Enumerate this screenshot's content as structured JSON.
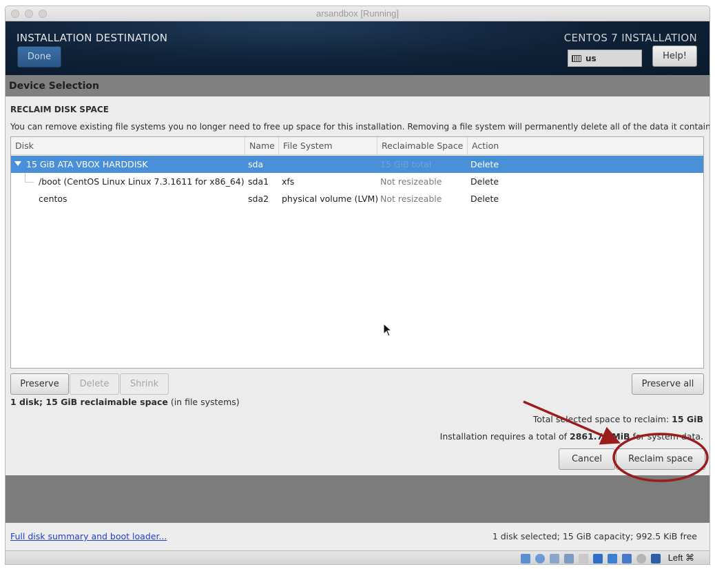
{
  "window": {
    "title": "arsandbox [Running]"
  },
  "header": {
    "title": "INSTALLATION DESTINATION",
    "done_label": "Done",
    "product": "CENTOS 7 INSTALLATION",
    "keyboard_layout": "us",
    "help_label": "Help!"
  },
  "dialog": {
    "section_header": "Device Selection",
    "title": "RECLAIM DISK SPACE",
    "description": "You can remove existing file systems you no longer need to free up space for this installation.  Removing a file system will permanently delete all of the data it contains.",
    "columns": [
      "Disk",
      "Name",
      "File System",
      "Reclaimable Space",
      "Action"
    ],
    "rows": [
      {
        "disk": "15 GiB ATA VBOX HARDDISK",
        "name": "sda",
        "fs": "",
        "reclaimable": "15 GiB total",
        "action": "Delete"
      },
      {
        "disk": "/boot (CentOS Linux Linux 7.3.1611 for x86_64)",
        "name": "sda1",
        "fs": "xfs",
        "reclaimable": "Not resizeable",
        "action": "Delete"
      },
      {
        "disk": "centos",
        "name": "sda2",
        "fs": "physical volume (LVM)",
        "reclaimable": "Not resizeable",
        "action": "Delete"
      }
    ],
    "buttons": {
      "preserve": "Preserve",
      "delete": "Delete",
      "shrink": "Shrink",
      "preserve_all": "Preserve all",
      "cancel": "Cancel",
      "reclaim": "Reclaim space"
    },
    "summary_bold": "1 disk; 15 GiB reclaimable space",
    "summary_rest": " (in file systems)",
    "total_label": "Total selected space to reclaim: ",
    "total_value": "15 GiB",
    "requires_pre": "Installation requires a total of ",
    "requires_value": "2861.72 MiB",
    "requires_post": " for system data."
  },
  "footer": {
    "link": "Full disk summary and boot loader...",
    "disk_status": "1 disk selected; 15 GiB capacity; 992.5 KiB free"
  },
  "statusbar": {
    "host_key": "Left ⌘"
  },
  "colors": {
    "selection": "#4a90d9",
    "annotation": "#9b1c1c",
    "header_bg": "#0f2238"
  }
}
